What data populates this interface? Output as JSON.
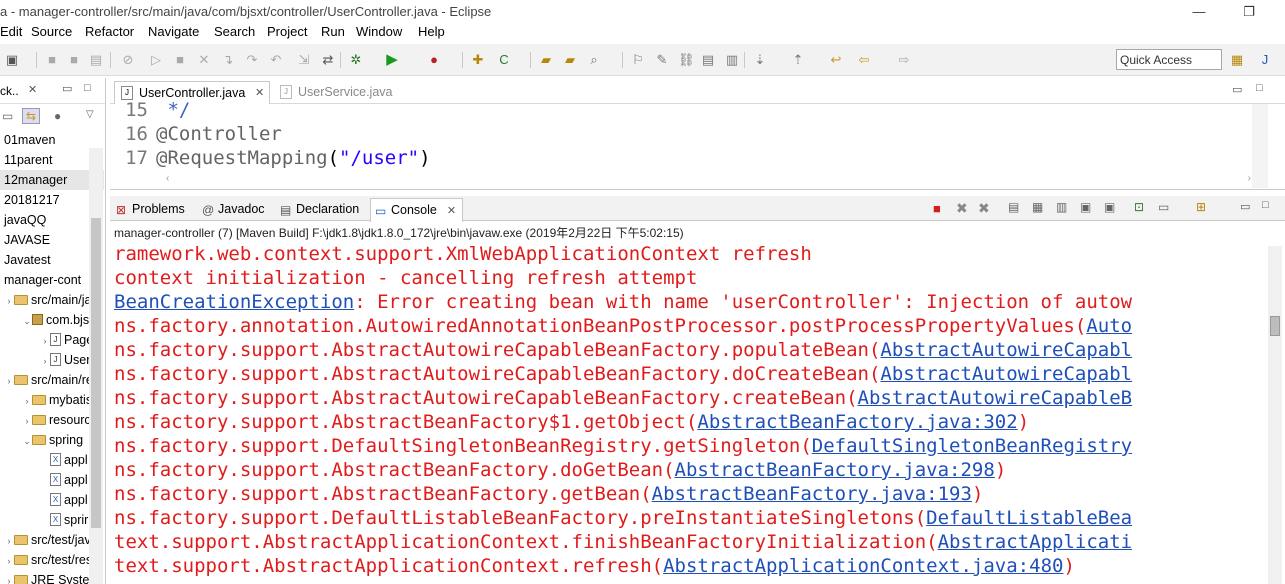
{
  "window": {
    "title": "a - manager-controller/src/main/java/com/bjsxt/controller/UserController.java - Eclipse",
    "minimize_glyph": "—",
    "restore_glyph": "❐"
  },
  "menu": [
    "Edit",
    "Source",
    "Refactor",
    "Navigate",
    "Search",
    "Project",
    "Run",
    "Window",
    "Help"
  ],
  "toolbar": {
    "quick_access_placeholder": "Quick Access",
    "icons": [
      "new-icon",
      "save-icon",
      "save-all-icon",
      "print-icon",
      "stop-icon",
      "skip-icon",
      "debug-icon",
      "run-icon",
      "external-tools-icon",
      "new-java-project-icon",
      "open-type-icon",
      "search-icon",
      "annotation-icon",
      "back-icon",
      "forward-icon",
      "perspective-icon"
    ]
  },
  "package_explorer": {
    "tab_label": "ck..",
    "items": [
      {
        "label": "01maven",
        "kind": "project",
        "indent": 0
      },
      {
        "label": "11parent",
        "kind": "project",
        "indent": 0
      },
      {
        "label": "12manager",
        "kind": "project",
        "indent": 0,
        "selected": true
      },
      {
        "label": "20181217",
        "kind": "project",
        "indent": 0
      },
      {
        "label": "javaQQ",
        "kind": "project",
        "indent": 0
      },
      {
        "label": "JAVASE",
        "kind": "project",
        "indent": 0
      },
      {
        "label": "Javatest",
        "kind": "project",
        "indent": 0
      },
      {
        "label": "manager-cont",
        "kind": "project",
        "indent": 0
      },
      {
        "label": "src/main/ja",
        "kind": "folder",
        "indent": 0
      },
      {
        "label": "com.bjs",
        "kind": "pkg",
        "indent": 1
      },
      {
        "label": "Page",
        "kind": "java",
        "indent": 2
      },
      {
        "label": "User",
        "kind": "java",
        "indent": 2
      },
      {
        "label": "src/main/re",
        "kind": "folder",
        "indent": 0
      },
      {
        "label": "mybatis",
        "kind": "folder",
        "indent": 1
      },
      {
        "label": "resourc",
        "kind": "folder",
        "indent": 1
      },
      {
        "label": "spring",
        "kind": "folder",
        "indent": 1
      },
      {
        "label": "appl",
        "kind": "xml",
        "indent": 2
      },
      {
        "label": "appl",
        "kind": "xml",
        "indent": 2
      },
      {
        "label": "appl",
        "kind": "xml",
        "indent": 2
      },
      {
        "label": "sprir",
        "kind": "xml",
        "indent": 2
      },
      {
        "label": "src/test/jav",
        "kind": "folder",
        "indent": 0
      },
      {
        "label": "src/test/res",
        "kind": "folder",
        "indent": 0
      },
      {
        "label": "JRE System",
        "kind": "folder",
        "indent": 0
      }
    ]
  },
  "editor": {
    "tabs": [
      {
        "label": "UserController.java",
        "active": true
      },
      {
        "label": "UserService.java",
        "active": false
      }
    ],
    "lines": [
      {
        "num": "15",
        "parts": [
          {
            "t": " */",
            "c": "comment"
          }
        ]
      },
      {
        "num": "16",
        "parts": [
          {
            "t": "@Controller",
            "c": "annot"
          }
        ]
      },
      {
        "num": "17",
        "parts": [
          {
            "t": "@RequestMapping",
            "c": "annot"
          },
          {
            "t": "(",
            "c": "plain"
          },
          {
            "t": "\"/user\"",
            "c": "str"
          },
          {
            "t": ")",
            "c": "plain"
          }
        ]
      }
    ]
  },
  "console_view": {
    "tabs": [
      "Problems",
      "Javadoc",
      "Declaration",
      "Console"
    ],
    "active_tab": "Console",
    "status": "manager-controller (7) [Maven Build] F:\\jdk1.8\\jdk1.8.0_172\\jre\\bin\\javaw.exe (2019年2月22日 下午5:02:15)",
    "lines": [
      [
        {
          "t": "ramework.web.context.support.XmlWebApplicationContext refresh"
        }
      ],
      [
        {
          "t": "context initialization - cancelling refresh attempt"
        }
      ],
      [
        {
          "t": "BeanCreationException",
          "link": true
        },
        {
          "t": ": Error creating bean with name 'userController': Injection of autow"
        }
      ],
      [
        {
          "t": "ns.factory.annotation.AutowiredAnnotationBeanPostProcessor.postProcessPropertyValues("
        },
        {
          "t": "Auto",
          "link": true
        }
      ],
      [
        {
          "t": "ns.factory.support.AbstractAutowireCapableBeanFactory.populateBean("
        },
        {
          "t": "AbstractAutowireCapabl",
          "link": true
        }
      ],
      [
        {
          "t": "ns.factory.support.AbstractAutowireCapableBeanFactory.doCreateBean("
        },
        {
          "t": "AbstractAutowireCapabl",
          "link": true
        }
      ],
      [
        {
          "t": "ns.factory.support.AbstractAutowireCapableBeanFactory.createBean("
        },
        {
          "t": "AbstractAutowireCapableB",
          "link": true
        }
      ],
      [
        {
          "t": "ns.factory.support.AbstractBeanFactory$1.getObject("
        },
        {
          "t": "AbstractBeanFactory.java:302",
          "link": true
        },
        {
          "t": ")"
        }
      ],
      [
        {
          "t": "ns.factory.support.DefaultSingletonBeanRegistry.getSingleton("
        },
        {
          "t": "DefaultSingletonBeanRegistry",
          "link": true
        }
      ],
      [
        {
          "t": "ns.factory.support.AbstractBeanFactory.doGetBean("
        },
        {
          "t": "AbstractBeanFactory.java:298",
          "link": true
        },
        {
          "t": ")"
        }
      ],
      [
        {
          "t": "ns.factory.support.AbstractBeanFactory.getBean("
        },
        {
          "t": "AbstractBeanFactory.java:193",
          "link": true
        },
        {
          "t": ")"
        }
      ],
      [
        {
          "t": "ns.factory.support.DefaultListableBeanFactory.preInstantiateSingletons("
        },
        {
          "t": "DefaultListableBea",
          "link": true
        }
      ],
      [
        {
          "t": "text.support.AbstractApplicationContext.finishBeanFactoryInitialization("
        },
        {
          "t": "AbstractApplicati",
          "link": true
        }
      ],
      [
        {
          "t": "text.support.AbstractApplicationContext.refresh("
        },
        {
          "t": "AbstractApplicationContext.java:480",
          "link": true
        },
        {
          "t": ")"
        }
      ]
    ]
  },
  "colors": {
    "error_text": "#e01b1b",
    "link": "#1f4fb8",
    "comment": "#3f5fbf",
    "annotation": "#646464",
    "string": "#2a00ff"
  }
}
